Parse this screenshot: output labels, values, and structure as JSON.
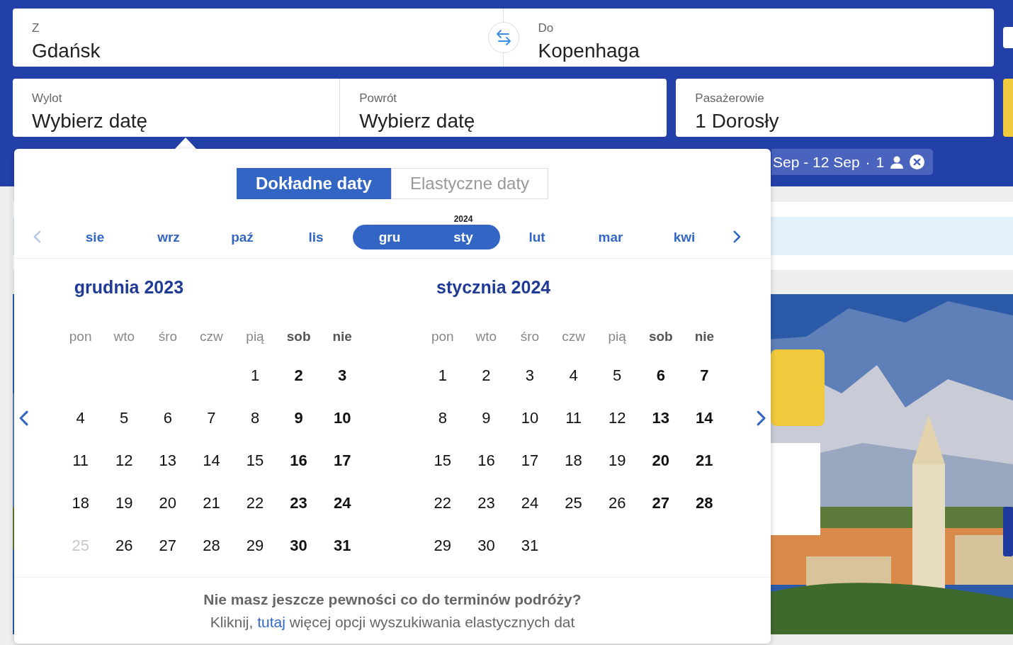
{
  "route": {
    "from": {
      "label": "Z",
      "value": "Gdańsk"
    },
    "to": {
      "label": "Do",
      "value": "Kopenhaga"
    }
  },
  "dates": [
    {
      "label": "Wylot",
      "value": "Wybierz datę"
    },
    {
      "label": "Powrót",
      "value": "Wybierz datę"
    }
  ],
  "passengers": {
    "label": "Pasażerowie",
    "value": "1 Dorosły"
  },
  "recent_search": {
    "dates": "Sep - 12 Sep",
    "separator": "·",
    "count": "1"
  },
  "picker": {
    "tabs": [
      {
        "label": "Dokładne daty",
        "selected": true
      },
      {
        "label": "Elastyczne daty",
        "selected": false
      }
    ],
    "month_strip": {
      "prev_disabled": true,
      "next_disabled": false,
      "months": [
        {
          "label": "sie",
          "selected": false
        },
        {
          "label": "wrz",
          "selected": false
        },
        {
          "label": "paź",
          "selected": false
        },
        {
          "label": "lis",
          "selected": false
        },
        {
          "label": "gru",
          "selected": true
        },
        {
          "label": "sty",
          "selected": true,
          "year": "2024"
        },
        {
          "label": "lut",
          "selected": false
        },
        {
          "label": "mar",
          "selected": false
        },
        {
          "label": "kwi",
          "selected": false
        }
      ]
    },
    "months": [
      {
        "title": "grudnia 2023",
        "weekdays": [
          {
            "label": "pon",
            "weekend": false
          },
          {
            "label": "wto",
            "weekend": false
          },
          {
            "label": "śro",
            "weekend": false
          },
          {
            "label": "czw",
            "weekend": false
          },
          {
            "label": "pią",
            "weekend": false
          },
          {
            "label": "sob",
            "weekend": true
          },
          {
            "label": "nie",
            "weekend": true
          }
        ],
        "weeks": [
          [
            {
              "kind": "blank"
            },
            {
              "kind": "blank"
            },
            {
              "kind": "blank"
            },
            {
              "kind": "blank"
            },
            {
              "kind": "day",
              "d": "1",
              "disabled": false
            },
            {
              "kind": "day",
              "d": "2",
              "disabled": false
            },
            {
              "kind": "day",
              "d": "3",
              "disabled": false
            }
          ],
          [
            {
              "kind": "day",
              "d": "4",
              "disabled": false
            },
            {
              "kind": "day",
              "d": "5",
              "disabled": false
            },
            {
              "kind": "day",
              "d": "6",
              "disabled": false
            },
            {
              "kind": "day",
              "d": "7",
              "disabled": false
            },
            {
              "kind": "day",
              "d": "8",
              "disabled": false
            },
            {
              "kind": "day",
              "d": "9",
              "disabled": false
            },
            {
              "kind": "day",
              "d": "10",
              "disabled": false
            }
          ],
          [
            {
              "kind": "day",
              "d": "11",
              "disabled": false
            },
            {
              "kind": "day",
              "d": "12",
              "disabled": false
            },
            {
              "kind": "day",
              "d": "13",
              "disabled": false
            },
            {
              "kind": "day",
              "d": "14",
              "disabled": false
            },
            {
              "kind": "day",
              "d": "15",
              "disabled": false
            },
            {
              "kind": "day",
              "d": "16",
              "disabled": false
            },
            {
              "kind": "day",
              "d": "17",
              "disabled": false
            }
          ],
          [
            {
              "kind": "day",
              "d": "18",
              "disabled": false
            },
            {
              "kind": "day",
              "d": "19",
              "disabled": false
            },
            {
              "kind": "day",
              "d": "20",
              "disabled": false
            },
            {
              "kind": "day",
              "d": "21",
              "disabled": false
            },
            {
              "kind": "day",
              "d": "22",
              "disabled": false
            },
            {
              "kind": "day",
              "d": "23",
              "disabled": false
            },
            {
              "kind": "day",
              "d": "24",
              "disabled": false
            }
          ],
          [
            {
              "kind": "day",
              "d": "25",
              "disabled": true
            },
            {
              "kind": "day",
              "d": "26",
              "disabled": false
            },
            {
              "kind": "day",
              "d": "27",
              "disabled": false
            },
            {
              "kind": "day",
              "d": "28",
              "disabled": false
            },
            {
              "kind": "day",
              "d": "29",
              "disabled": false
            },
            {
              "kind": "day",
              "d": "30",
              "disabled": false
            },
            {
              "kind": "day",
              "d": "31",
              "disabled": false
            }
          ]
        ]
      },
      {
        "title": "stycznia 2024",
        "weekdays": [
          {
            "label": "pon",
            "weekend": false
          },
          {
            "label": "wto",
            "weekend": false
          },
          {
            "label": "śro",
            "weekend": false
          },
          {
            "label": "czw",
            "weekend": false
          },
          {
            "label": "pią",
            "weekend": false
          },
          {
            "label": "sob",
            "weekend": true
          },
          {
            "label": "nie",
            "weekend": true
          }
        ],
        "weeks": [
          [
            {
              "kind": "day",
              "d": "1",
              "disabled": false
            },
            {
              "kind": "day",
              "d": "2",
              "disabled": false
            },
            {
              "kind": "day",
              "d": "3",
              "disabled": false
            },
            {
              "kind": "day",
              "d": "4",
              "disabled": false
            },
            {
              "kind": "day",
              "d": "5",
              "disabled": false
            },
            {
              "kind": "day",
              "d": "6",
              "disabled": false
            },
            {
              "kind": "day",
              "d": "7",
              "disabled": false
            }
          ],
          [
            {
              "kind": "day",
              "d": "8",
              "disabled": false
            },
            {
              "kind": "day",
              "d": "9",
              "disabled": false
            },
            {
              "kind": "day",
              "d": "10",
              "disabled": false
            },
            {
              "kind": "day",
              "d": "11",
              "disabled": false
            },
            {
              "kind": "day",
              "d": "12",
              "disabled": false
            },
            {
              "kind": "day",
              "d": "13",
              "disabled": false
            },
            {
              "kind": "day",
              "d": "14",
              "disabled": false
            }
          ],
          [
            {
              "kind": "day",
              "d": "15",
              "disabled": false
            },
            {
              "kind": "day",
              "d": "16",
              "disabled": false
            },
            {
              "kind": "day",
              "d": "17",
              "disabled": false
            },
            {
              "kind": "day",
              "d": "18",
              "disabled": false
            },
            {
              "kind": "day",
              "d": "19",
              "disabled": false
            },
            {
              "kind": "day",
              "d": "20",
              "disabled": false
            },
            {
              "kind": "day",
              "d": "21",
              "disabled": false
            }
          ],
          [
            {
              "kind": "day",
              "d": "22",
              "disabled": false
            },
            {
              "kind": "day",
              "d": "23",
              "disabled": false
            },
            {
              "kind": "day",
              "d": "24",
              "disabled": false
            },
            {
              "kind": "day",
              "d": "25",
              "disabled": false
            },
            {
              "kind": "day",
              "d": "26",
              "disabled": false
            },
            {
              "kind": "day",
              "d": "27",
              "disabled": false
            },
            {
              "kind": "day",
              "d": "28",
              "disabled": false
            }
          ],
          [
            {
              "kind": "day",
              "d": "29",
              "disabled": false
            },
            {
              "kind": "day",
              "d": "30",
              "disabled": false
            },
            {
              "kind": "day",
              "d": "31",
              "disabled": false
            }
          ]
        ]
      }
    ],
    "footer": {
      "question": "Nie masz jeszcze pewności co do terminów podróży?",
      "before": "Kliknij,",
      "link": "tutaj",
      "after": "więcej opcji wyszukiwania elastycznych dat"
    }
  }
}
